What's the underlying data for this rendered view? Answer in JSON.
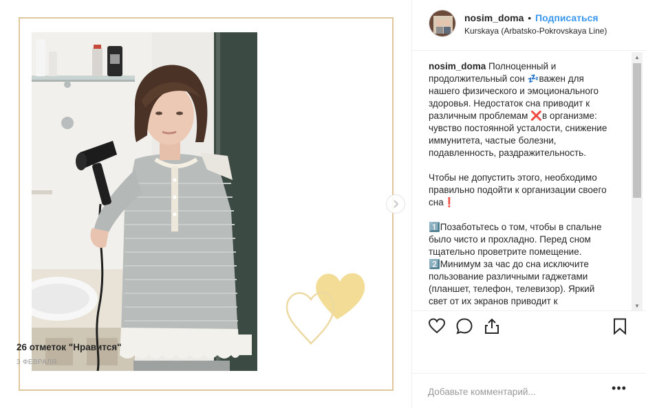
{
  "header": {
    "username": "nosim_doma",
    "separator": "•",
    "follow_label": "Подписаться",
    "location": "Kurskaya (Arbatsko-Pokrovskaya Line)"
  },
  "caption": {
    "username": "nosim_doma",
    "paragraph1": "Полноценный и продолжительный сон 💤важен для нашего физического и эмоционального здоровья. Недостаток сна приводит к различным проблемам ❌в организме: чувство постоянной усталости, снижение иммунитета, частые болезни, подавленность, раздражительность.",
    "paragraph2": "Чтобы не допустить этого, необходимо правильно подойти к организации своего сна❗",
    "item1": "1️⃣Позаботьтесь о том, чтобы в спальне было чисто и прохладно. Перед сном тщательно проветрите помещение.",
    "item2": "2️⃣Минимум за час до сна исключите пользование различными гаджетами (планшет, телефон, телевизор). Яркий свет от их экранов приводит к"
  },
  "actions": {
    "like_icon": "heart-icon",
    "comment_icon": "comment-icon",
    "share_icon": "share-icon",
    "save_icon": "bookmark-icon"
  },
  "likes_text": "26 отметок \"Нравится\"",
  "date": "3 ФЕВРАЛЯ",
  "comment": {
    "placeholder": "Добавьте комментарий...",
    "more_label": "•••"
  },
  "colors": {
    "frame_border": "#e0c79b",
    "heart_filled": "#f2dc96",
    "heart_outline": "#edd9a2",
    "link_blue": "#3897f0"
  }
}
